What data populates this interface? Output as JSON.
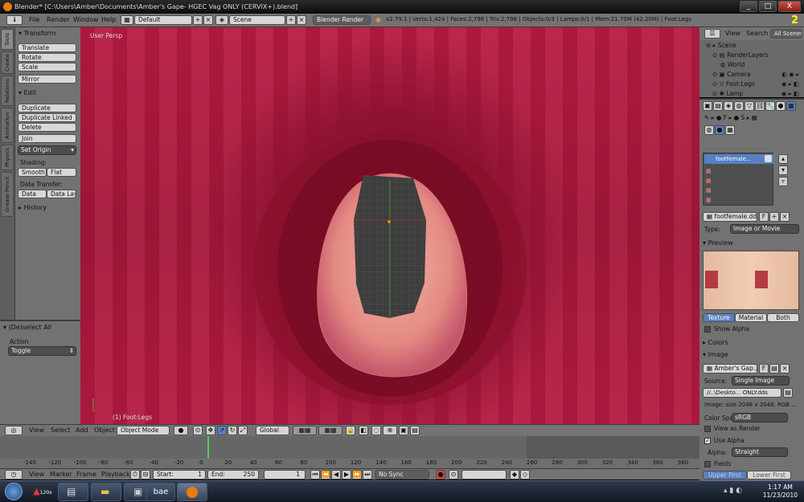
{
  "window": {
    "title": "Blender* [C:\\Users\\Amber\\Documents\\Amber's Gape- HGEC Vag ONLY (CERVIX+).blend]",
    "min": "_",
    "max": "□",
    "close": "X"
  },
  "info_header": {
    "menus": [
      "File",
      "Render",
      "Window",
      "Help"
    ],
    "layout": "Default",
    "scene": "Scene",
    "engine": "Blender Render",
    "stats": "v2.79.1 | Verts:1,424 | Faces:2,798 | Tris:2,798 | Objects:0/3 | Lamps:0/1 | Mem:21.70M (42.20M) | Foot:Legs"
  },
  "tool_tabs": [
    "Tools",
    "Create",
    "Relations",
    "Animation",
    "Physics",
    "Grease Pencil"
  ],
  "tool_shelf": {
    "transform": {
      "title": "Transform",
      "buttons": [
        "Translate",
        "Rotate",
        "Scale",
        "Mirror"
      ]
    },
    "edit": {
      "title": "Edit",
      "buttons": [
        "Duplicate",
        "Duplicate Linked",
        "Delete",
        "Join"
      ],
      "set_origin": "Set Origin",
      "shading_label": "Shading:",
      "shading": [
        "Smooth",
        "Flat"
      ],
      "data_transfer_label": "Data Transfer:",
      "data_transfer": [
        "Data",
        "Data Layo"
      ]
    },
    "history": "History"
  },
  "operator_panel": {
    "title": "(De)select All",
    "action_label": "Action",
    "action_value": "Toggle"
  },
  "viewport": {
    "view_label": "User Persp",
    "object_label": "(1) Foot:Legs"
  },
  "view3d_header": {
    "menus": [
      "View",
      "Select",
      "Add",
      "Object"
    ],
    "mode": "Object Mode",
    "orientation": "Global"
  },
  "timeline": {
    "ticks": [
      "-140",
      "-120",
      "-100",
      "-80",
      "-60",
      "-40",
      "-20",
      "0",
      "20",
      "40",
      "60",
      "80",
      "100",
      "120",
      "140",
      "160",
      "180",
      "200",
      "220",
      "240",
      "260",
      "280",
      "300",
      "320",
      "340",
      "360",
      "380"
    ],
    "current_frame": 1,
    "menus": [
      "View",
      "Marker",
      "Frame",
      "Playback"
    ],
    "start_label": "Start:",
    "start": "1",
    "end_label": "End:",
    "end": "250",
    "frame": "1",
    "sync": "No Sync"
  },
  "outliner": {
    "tabs": [
      "View",
      "Search",
      "All Scenes"
    ],
    "items": [
      "Scene",
      "RenderLayers",
      "World",
      "Camera",
      "Foot:Legs",
      "Lamp"
    ]
  },
  "properties": {
    "texture_slot": "footfemale.dds",
    "slot_name": "footfemale...",
    "f_label": "F",
    "type_label": "Type:",
    "type_value": "Image or Movie",
    "preview_title": "Preview",
    "preview_tabs": [
      "Texture",
      "Material",
      "Both"
    ],
    "show_alpha": "Show Alpha",
    "colors_title": "Colors",
    "image_title": "Image",
    "image_name": "Amber's Gap...",
    "source_label": "Source:",
    "source_value": "Single Image",
    "path": "//..\\Deskto... ONLY.dds",
    "image_info": "Image: size 2048 x 2048, RGB ...",
    "colorspace_label": "Color Spa",
    "colorspace_value": "sRGB",
    "view_as_render": "View as Render",
    "use_alpha": "Use Alpha",
    "alpha_label": "Alpha:",
    "alpha_value": "Straight",
    "fields": "Fields",
    "field_order": [
      "Upper First",
      "Lower First"
    ]
  },
  "taskbar": {
    "items": [
      "120x",
      "bae"
    ],
    "time": "1:17 AM",
    "date": "11/23/2010"
  },
  "corner_number": "2",
  "colors": {
    "accent": "#e87d0d",
    "viewport_red": "#a4163a",
    "selected_blue": "#5680c2"
  }
}
